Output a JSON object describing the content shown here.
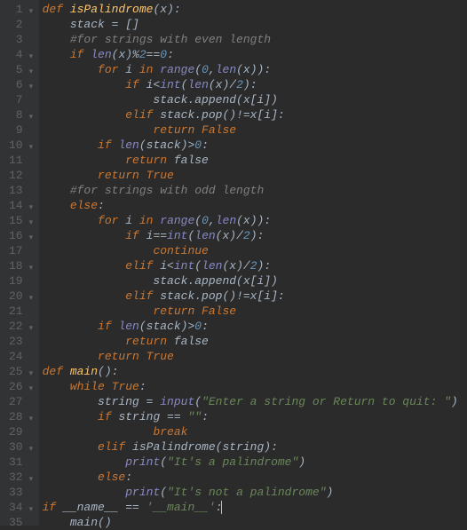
{
  "lines": [
    {
      "num": "1",
      "fold": "▾",
      "html": "<span class='kw'>def </span><span class='fn'>isPalindrome</span>(x):"
    },
    {
      "num": "2",
      "fold": "",
      "html": "    stack = []"
    },
    {
      "num": "3",
      "fold": "",
      "html": "    <span class='cmt'>#for strings with even length</span>"
    },
    {
      "num": "4",
      "fold": "▾",
      "html": "    <span class='kw'>if </span><span class='bi'>len</span>(x)%<span class='num'>2</span>==<span class='num'>0</span>:"
    },
    {
      "num": "5",
      "fold": "▾",
      "html": "        <span class='kw'>for </span>i <span class='kw'>in </span><span class='bi'>range</span>(<span class='num'>0</span><span class='op'>,</span><span class='bi'>len</span>(x)):"
    },
    {
      "num": "6",
      "fold": "▾",
      "html": "            <span class='kw'>if </span>i&lt;<span class='bi'>int</span>(<span class='bi'>len</span>(x)/<span class='num'>2</span>):"
    },
    {
      "num": "7",
      "fold": "",
      "html": "                stack.append(x[i])"
    },
    {
      "num": "8",
      "fold": "▾",
      "html": "            <span class='kw'>elif </span>stack.pop()!=x[i]:"
    },
    {
      "num": "9",
      "fold": "",
      "html": "                <span class='kw'>return </span><span class='kw'>False</span>"
    },
    {
      "num": "10",
      "fold": "▾",
      "html": "        <span class='kw'>if </span><span class='bi'>len</span>(stack)&gt;<span class='num'>0</span>:"
    },
    {
      "num": "11",
      "fold": "",
      "html": "            <span class='kw'>return </span>false"
    },
    {
      "num": "12",
      "fold": "",
      "html": "        <span class='kw'>return </span><span class='kw'>True</span>"
    },
    {
      "num": "13",
      "fold": "",
      "html": "    <span class='cmt'>#for strings with odd length</span>"
    },
    {
      "num": "14",
      "fold": "▾",
      "html": "    <span class='kw'>else</span>:"
    },
    {
      "num": "15",
      "fold": "▾",
      "html": "        <span class='kw'>for </span>i <span class='kw'>in </span><span class='bi'>range</span>(<span class='num'>0</span><span class='op'>,</span><span class='bi'>len</span>(x)):"
    },
    {
      "num": "16",
      "fold": "▾",
      "html": "            <span class='kw'>if </span>i==<span class='bi'>int</span>(<span class='bi'>len</span>(x)/<span class='num'>2</span>):"
    },
    {
      "num": "17",
      "fold": "",
      "html": "                <span class='kw'>continue</span>"
    },
    {
      "num": "18",
      "fold": "▾",
      "html": "            <span class='kw'>elif </span>i&lt;<span class='bi'>int</span>(<span class='bi'>len</span>(x)/<span class='num'>2</span>):"
    },
    {
      "num": "19",
      "fold": "",
      "html": "                stack.append(x[i])"
    },
    {
      "num": "20",
      "fold": "▾",
      "html": "            <span class='kw'>elif </span>stack.pop()!=x[i]:"
    },
    {
      "num": "21",
      "fold": "",
      "html": "                <span class='kw'>return </span><span class='kw'>False</span>"
    },
    {
      "num": "22",
      "fold": "▾",
      "html": "        <span class='kw'>if </span><span class='bi'>len</span>(stack)&gt;<span class='num'>0</span>:"
    },
    {
      "num": "23",
      "fold": "",
      "html": "            <span class='kw'>return </span>false"
    },
    {
      "num": "24",
      "fold": "",
      "html": "        <span class='kw'>return </span><span class='kw'>True</span>"
    },
    {
      "num": "25",
      "fold": "▾",
      "html": "<span class='kw'>def </span><span class='fn'>main</span>():"
    },
    {
      "num": "26",
      "fold": "▾",
      "html": "    <span class='kw'>while </span><span class='kw'>True</span>:"
    },
    {
      "num": "27",
      "fold": "",
      "html": "        string = <span class='bi'>input</span>(<span class='str'>\"Enter a string or Return to quit: \"</span>)"
    },
    {
      "num": "28",
      "fold": "▾",
      "html": "        <span class='kw'>if </span>string == <span class='str'>\"\"</span>:"
    },
    {
      "num": "29",
      "fold": "",
      "html": "                <span class='kw'>break</span>"
    },
    {
      "num": "30",
      "fold": "▾",
      "html": "        <span class='kw'>elif </span>isPalindrome(string):"
    },
    {
      "num": "31",
      "fold": "",
      "html": "            <span class='bi'>print</span>(<span class='str'>\"It's a palindrome\"</span>)"
    },
    {
      "num": "32",
      "fold": "▾",
      "html": "        <span class='kw'>else</span>:"
    },
    {
      "num": "33",
      "fold": "",
      "html": "            <span class='bi'>print</span>(<span class='str'>\"It's not a palindrome\"</span>)"
    },
    {
      "num": "34",
      "fold": "▾",
      "html": "<span class='kw'>if </span>__name__ == <span class='str'>'__main__'</span>:<span class='cursor'></span>"
    },
    {
      "num": "35",
      "fold": "",
      "html": "    main()"
    }
  ]
}
